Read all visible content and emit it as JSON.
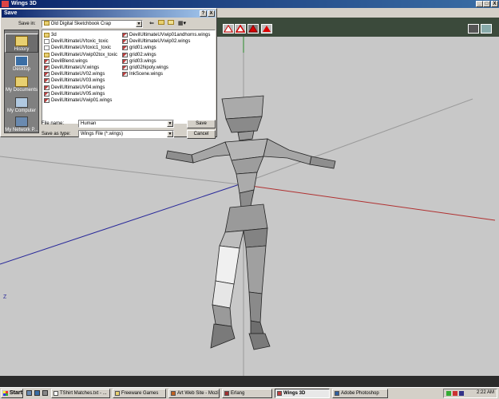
{
  "main_window": {
    "title": "Wings 3D",
    "controls": [
      "_",
      "□",
      "X"
    ],
    "axis_label": "Z"
  },
  "toolbar": {
    "tools": [
      "vertex-mode",
      "edge-mode",
      "face-mode",
      "body-mode"
    ]
  },
  "save_dialog": {
    "title": "Save",
    "controls": [
      "?",
      "X"
    ],
    "save_in_label": "Save in:",
    "save_in_value": "Old Digital Sketchbook Crap",
    "places": [
      {
        "label": "History",
        "icon": "history-icon"
      },
      {
        "label": "Desktop",
        "icon": "desktop-icon"
      },
      {
        "label": "My Documents",
        "icon": "my-documents-icon"
      },
      {
        "label": "My Computer",
        "icon": "my-computer-icon"
      },
      {
        "label": "My Network P...",
        "icon": "network-icon"
      }
    ],
    "files_col1": [
      {
        "name": "3d",
        "type": "folder"
      },
      {
        "name": "DevilUltimateUVtoxic_toxic",
        "type": "toxic"
      },
      {
        "name": "DevilUltimateUVtoxic1_toxic",
        "type": "toxic"
      },
      {
        "name": "DevilUltimateUVwip02tox_toxic",
        "type": "folder"
      },
      {
        "name": "DevilBlend.wings",
        "type": "wings"
      },
      {
        "name": "DevilUltimateUV.wings",
        "type": "wings"
      },
      {
        "name": "DevilUltimateUV02.wings",
        "type": "wings"
      },
      {
        "name": "DevilUltimateUV03.wings",
        "type": "wings"
      },
      {
        "name": "DevilUltimateUV04.wings",
        "type": "wings"
      },
      {
        "name": "DevilUltimateUV05.wings",
        "type": "wings"
      },
      {
        "name": "DevilUltimateUVwip01.wings",
        "type": "wings"
      }
    ],
    "files_col2": [
      {
        "name": "DevilUltimateUVwip01andhorns.wings",
        "type": "wings"
      },
      {
        "name": "DevilUltimateUVwip02.wings",
        "type": "wings"
      },
      {
        "name": "grid01.wings",
        "type": "wings"
      },
      {
        "name": "grid02.wings",
        "type": "wings"
      },
      {
        "name": "grid03.wings",
        "type": "wings"
      },
      {
        "name": "grid02hipoly.wings",
        "type": "wings"
      },
      {
        "name": "InkScene.wings",
        "type": "wings"
      }
    ],
    "file_name_label": "File name:",
    "file_name_value": "Human",
    "save_as_type_label": "Save as type:",
    "save_as_type_value": "Wings File (*.wings)",
    "save_button": "Save",
    "cancel_button": "Cancel",
    "nav_icons": [
      "back-icon",
      "up-folder-icon",
      "new-folder-icon",
      "view-menu-icon"
    ]
  },
  "taskbar": {
    "start_label": "Start",
    "tasks": [
      {
        "label": "TShirt Matches.txt - ..."
      },
      {
        "label": "Freeware Games"
      },
      {
        "label": "Art Web Site - Mozilla"
      },
      {
        "label": "Erlang"
      },
      {
        "label": "Wings 3D",
        "active": true
      },
      {
        "label": "Adobe Photoshop"
      }
    ],
    "clock": "2:22 AM"
  }
}
